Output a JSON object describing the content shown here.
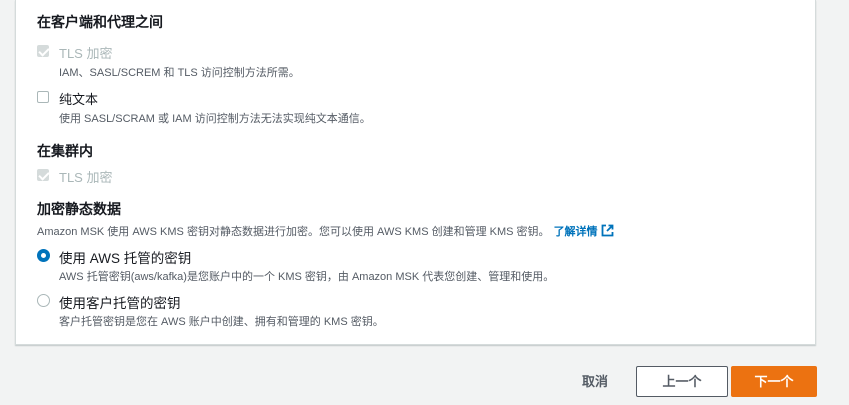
{
  "client_broker": {
    "title": "在客户端和代理之间",
    "tls": {
      "label": "TLS 加密",
      "description": "IAM、SASL/SCREM 和 TLS 访问控制方法所需。",
      "checked": true,
      "disabled": true
    },
    "plaintext": {
      "label": "纯文本",
      "description": "使用 SASL/SCRAM 或 IAM 访问控制方法无法实现纯文本通信。",
      "checked": false
    }
  },
  "within_cluster": {
    "title": "在集群内",
    "tls": {
      "label": "TLS 加密",
      "checked": true,
      "disabled": true
    }
  },
  "at_rest": {
    "title": "加密静态数据",
    "help": "Amazon MSK 使用 AWS KMS 密钥对静态数据进行加密。您可以使用 AWS KMS 创建和管理 KMS 密钥。",
    "learn_more": "了解详情",
    "learn_more_icon": "external-link-icon",
    "aws_managed": {
      "label": "使用 AWS 托管的密钥",
      "description": "AWS 托管密钥(aws/kafka)是您账户中的一个 KMS 密钥，由 Amazon MSK 代表您创建、管理和使用。",
      "selected": true
    },
    "customer_managed": {
      "label": "使用客户托管的密钥",
      "description": "客户托管密钥是您在 AWS 账户中创建、拥有和管理的 KMS 密钥。",
      "selected": false
    }
  },
  "footer": {
    "cancel": "取消",
    "previous": "上一个",
    "next": "下一个"
  },
  "colors": {
    "accent": "#0073bb",
    "primary_button": "#ec7211",
    "disabled": "#aab7b8"
  }
}
